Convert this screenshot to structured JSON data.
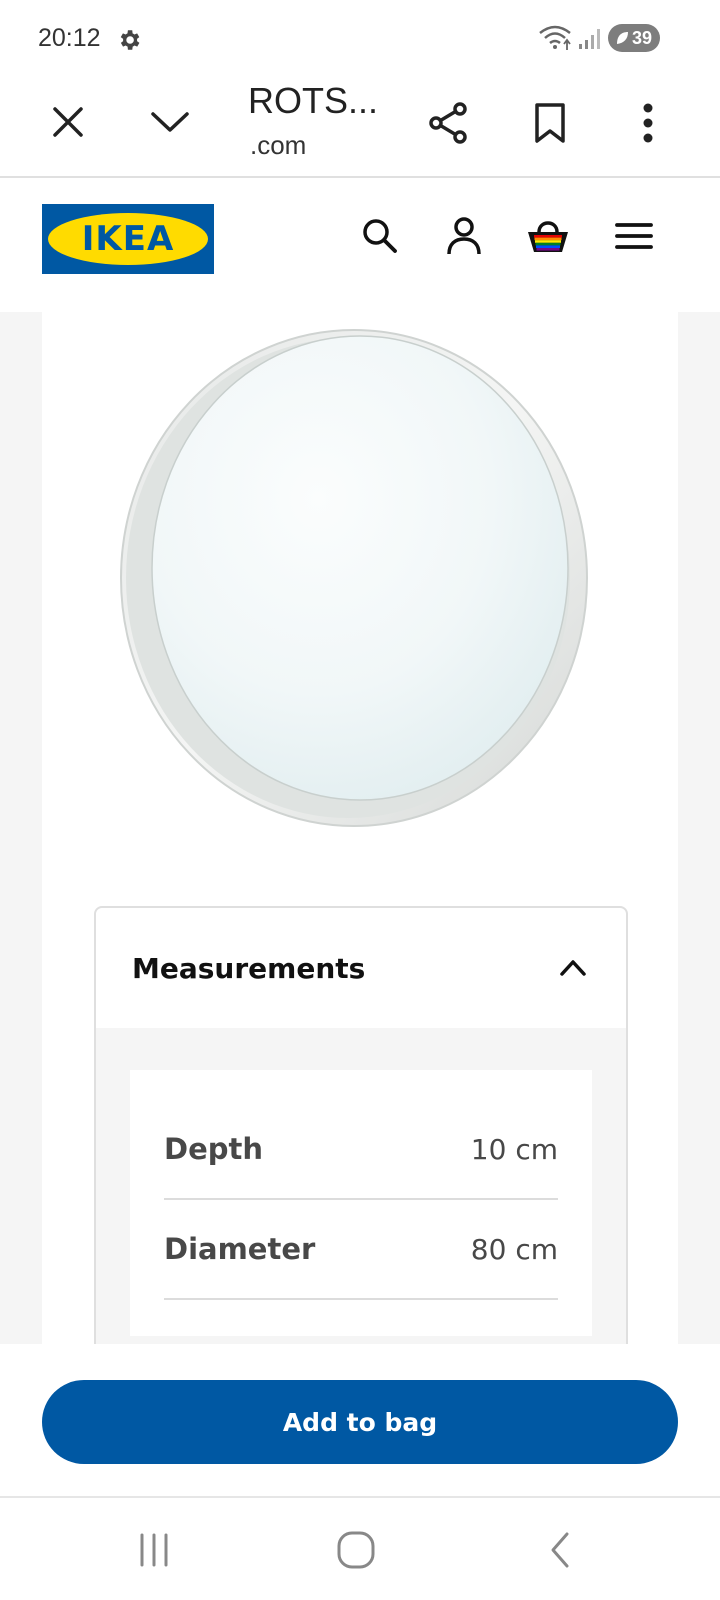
{
  "status_bar": {
    "time": "20:12",
    "battery": "39",
    "icons": [
      "gear-icon",
      "wifi-icon",
      "signal-icon",
      "battery-icon"
    ]
  },
  "browser": {
    "title": "ROTS...",
    "domain": ".com",
    "icons": [
      "close-icon",
      "chevron-down-icon",
      "share-icon",
      "bookmark-icon",
      "more-vertical-icon"
    ]
  },
  "header": {
    "logo_text": "IKEA",
    "icons": [
      "search-icon",
      "profile-icon",
      "basket-icon",
      "menu-icon"
    ],
    "brand_blue": "#0058a3",
    "brand_yellow": "#ffdb00"
  },
  "measurements": {
    "title": "Measurements",
    "rows": [
      {
        "label": "Depth",
        "value": "10 cm"
      },
      {
        "label": "Diameter",
        "value": "80 cm"
      }
    ]
  },
  "actions": {
    "add_to_bag": "Add to bag"
  },
  "system_nav": {
    "icons": [
      "recents-icon",
      "home-icon",
      "back-icon"
    ]
  }
}
